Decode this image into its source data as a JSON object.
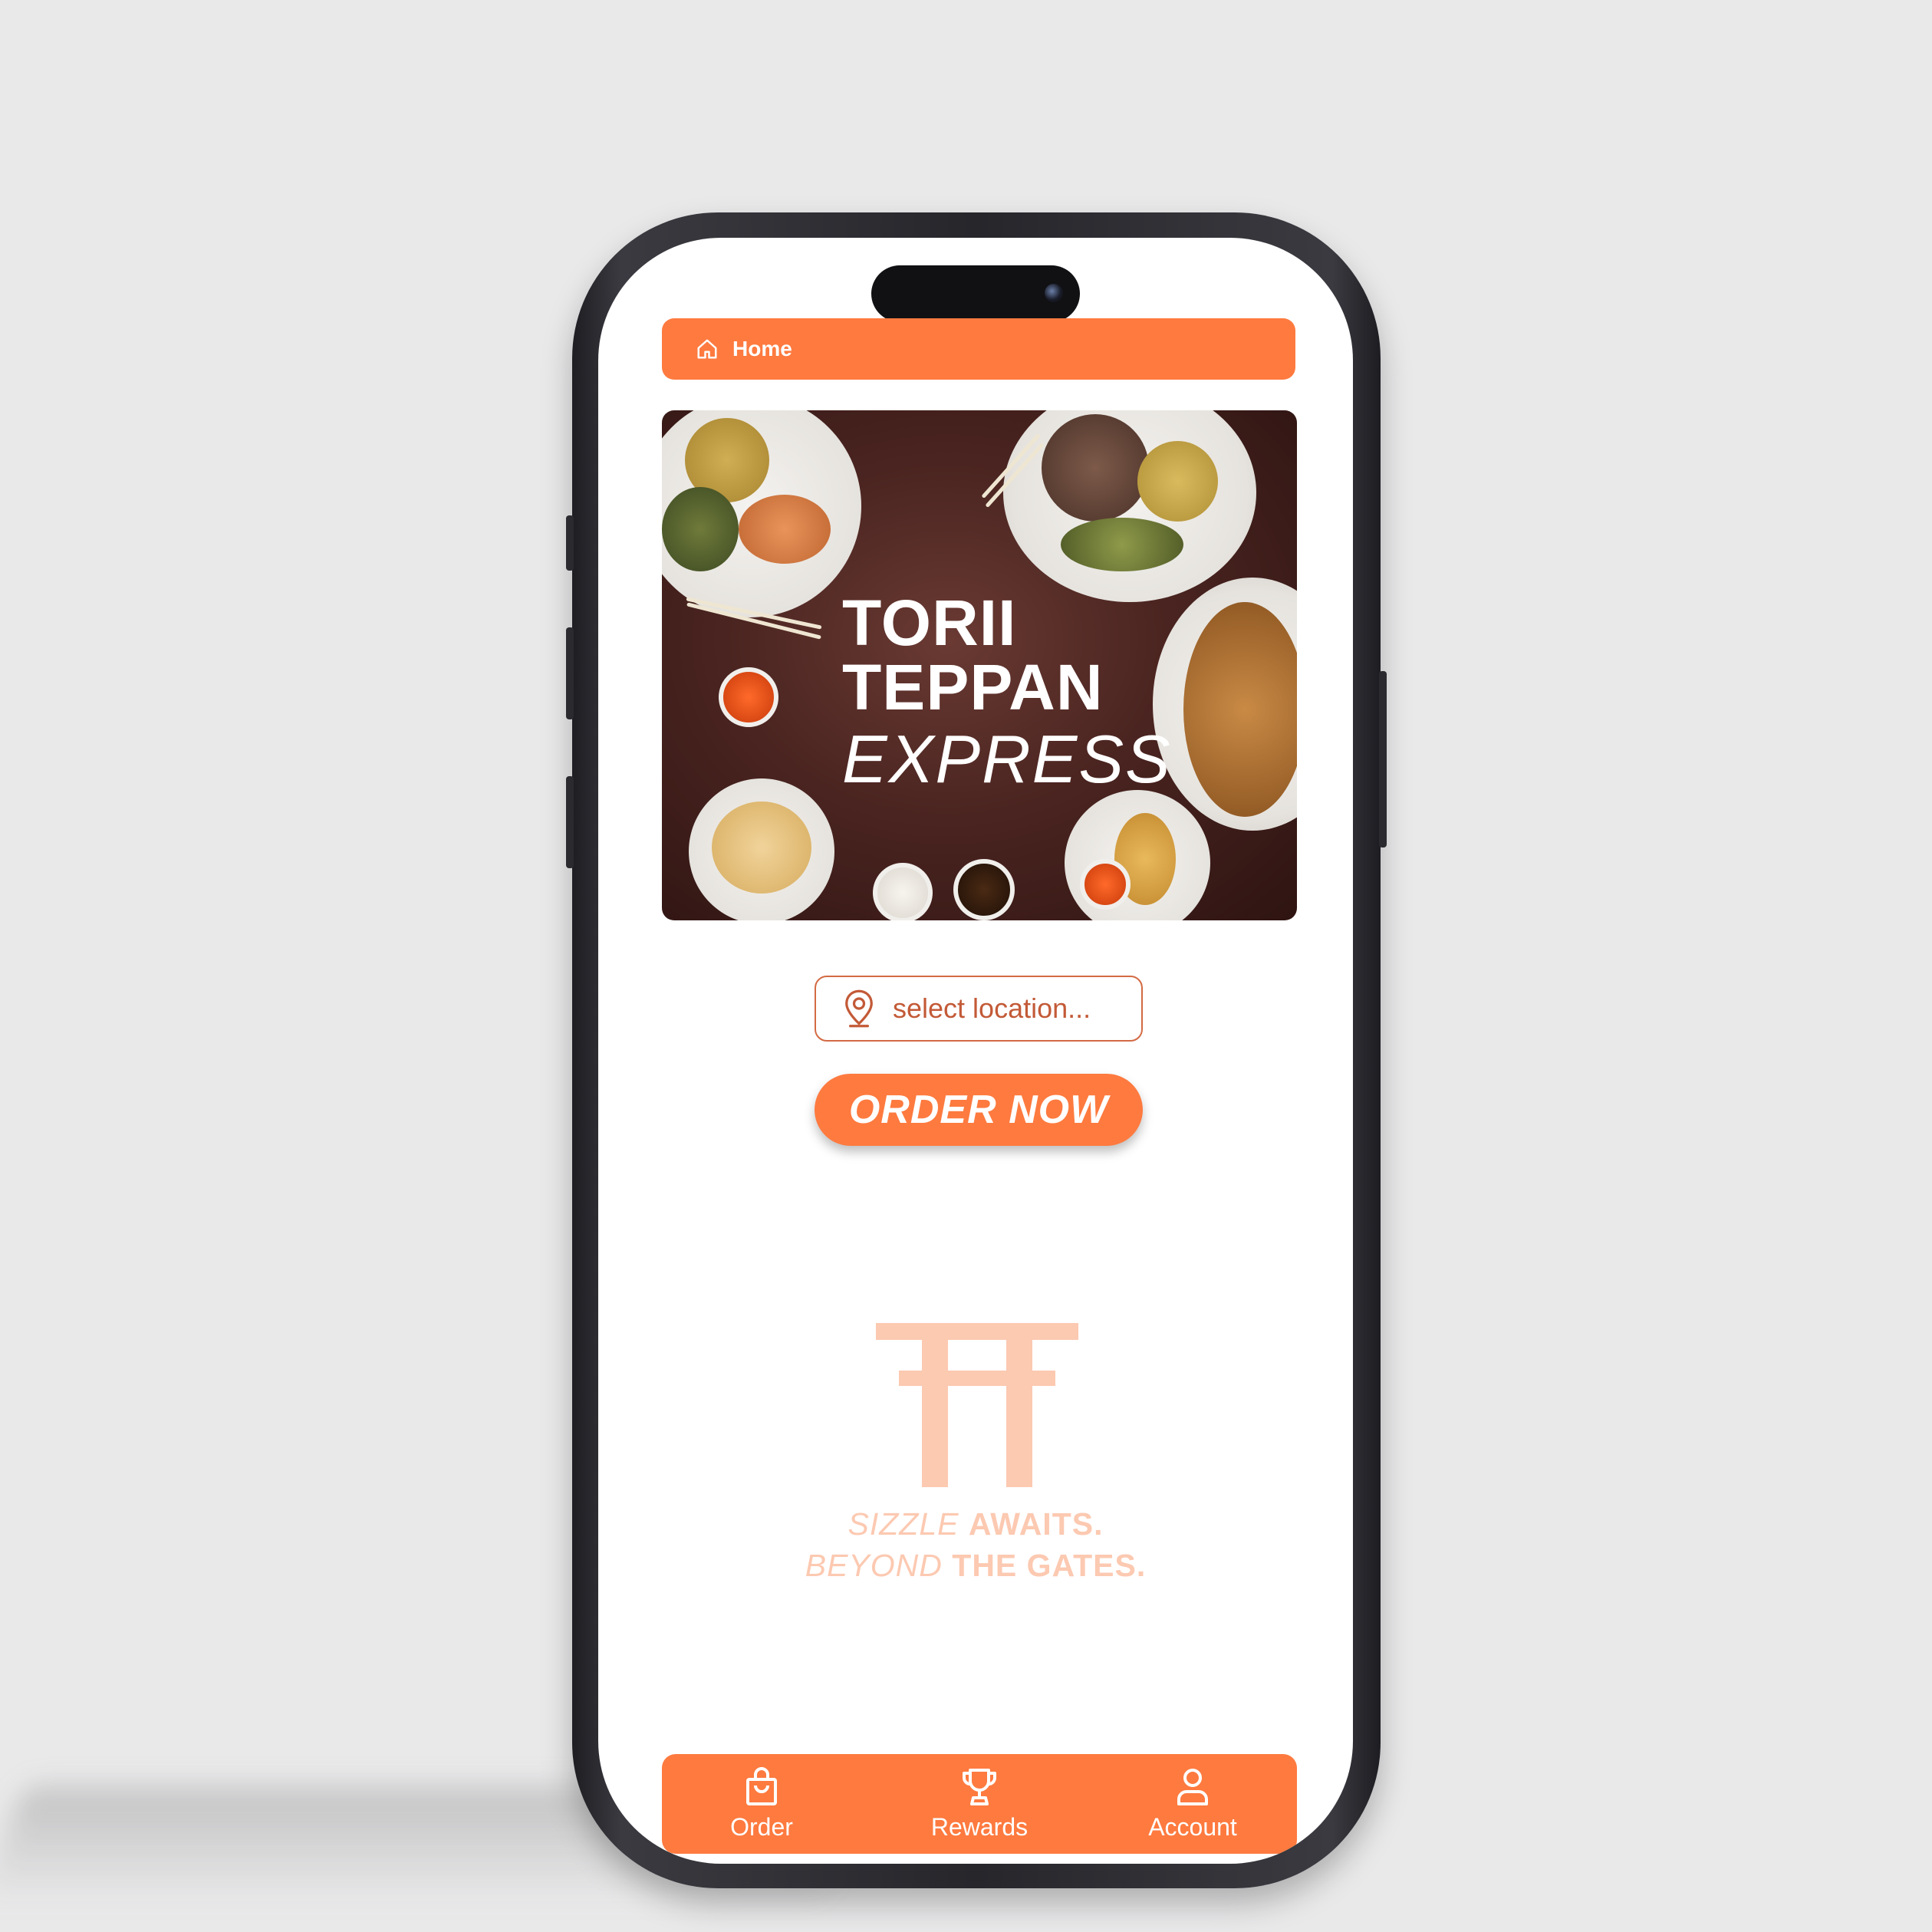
{
  "header": {
    "title": "Home",
    "icon": "home-icon"
  },
  "hero": {
    "brand_line1": "TORII",
    "brand_line2": "TEPPAN",
    "brand_line3": "EXPRESS"
  },
  "location": {
    "placeholder": "select location...",
    "icon": "location-pin-icon"
  },
  "order_button": {
    "label": "ORDER NOW"
  },
  "tagline": {
    "line1_light": "SIZZLE",
    "line1_bold": "AWAITS.",
    "line2_light": "BEYOND",
    "line2_bold": "THE GATES."
  },
  "tabbar": {
    "items": [
      {
        "label": "Order",
        "icon": "shopping-bag-icon"
      },
      {
        "label": "Rewards",
        "icon": "trophy-icon"
      },
      {
        "label": "Account",
        "icon": "user-icon"
      }
    ]
  },
  "colors": {
    "accent": "#fe7a3f",
    "tagline": "#fcc9b1",
    "location_text": "#c35a37",
    "background": "#e9e9ea"
  }
}
